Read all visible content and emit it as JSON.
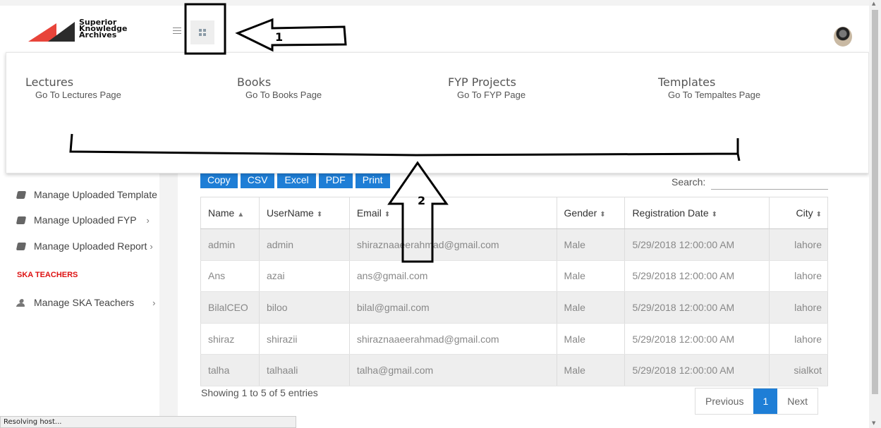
{
  "header": {
    "logo_text": "Superior\nKnowledge\nArchives",
    "logo_colors": {
      "red": "#e8443a",
      "dark": "#2b2b2b"
    }
  },
  "sidebar": {
    "items": [
      {
        "label": "Manage Uploaded Template",
        "icon": "book-icon"
      },
      {
        "label": "Manage Uploaded FYP",
        "icon": "book-icon"
      },
      {
        "label": "Manage Uploaded Report",
        "icon": "book-icon"
      }
    ],
    "teachers_heading": "SKA TEACHERS",
    "teacher_item": {
      "label": "Manage SKA Teachers",
      "icon": "user-icon"
    }
  },
  "mega_menu": {
    "columns": [
      {
        "title": "Lectures",
        "link": "Go To Lectures Page"
      },
      {
        "title": "Books",
        "link": "Go To Books Page"
      },
      {
        "title": "FYP Projects",
        "link": "Go To FYP Page"
      },
      {
        "title": "Templates",
        "link": "Go To Tempaltes Page"
      }
    ]
  },
  "toolbar": {
    "buttons": [
      "Copy",
      "CSV",
      "Excel",
      "PDF",
      "Print"
    ],
    "search_label": "Search:"
  },
  "table": {
    "headers": [
      "Name",
      "UserName",
      "Email",
      "Gender",
      "Registration Date",
      "City"
    ],
    "rows": [
      [
        "admin",
        "admin",
        "shiraznaaeerahmad@gmail.com",
        "Male",
        "5/29/2018 12:00:00 AM",
        "lahore"
      ],
      [
        "Ans",
        "azai",
        "ans@gmail.com",
        "Male",
        "5/29/2018 12:00:00 AM",
        "lahore"
      ],
      [
        "BilalCEO",
        "biloo",
        "bilal@gmail.com",
        "Male",
        "5/29/2018 12:00:00 AM",
        "lahore"
      ],
      [
        "shiraz",
        "shirazii",
        "shiraznaaeerahmad@gmail.com",
        "Male",
        "5/29/2018 12:00:00 AM",
        "lahore"
      ],
      [
        "talha",
        "talhaali",
        "talha@gmail.com",
        "Male",
        "5/29/2018 12:00:00 AM",
        "sialkot"
      ]
    ]
  },
  "footer": {
    "info": "Showing 1 to 5 of 5 entries",
    "previous": "Previous",
    "current_page": "1",
    "next": "Next"
  },
  "annotations": {
    "one": "1",
    "two": "2"
  },
  "status_bar": "Resolving host...",
  "colors": {
    "primary": "#1e7ed6",
    "accent_red": "#dd1111"
  }
}
